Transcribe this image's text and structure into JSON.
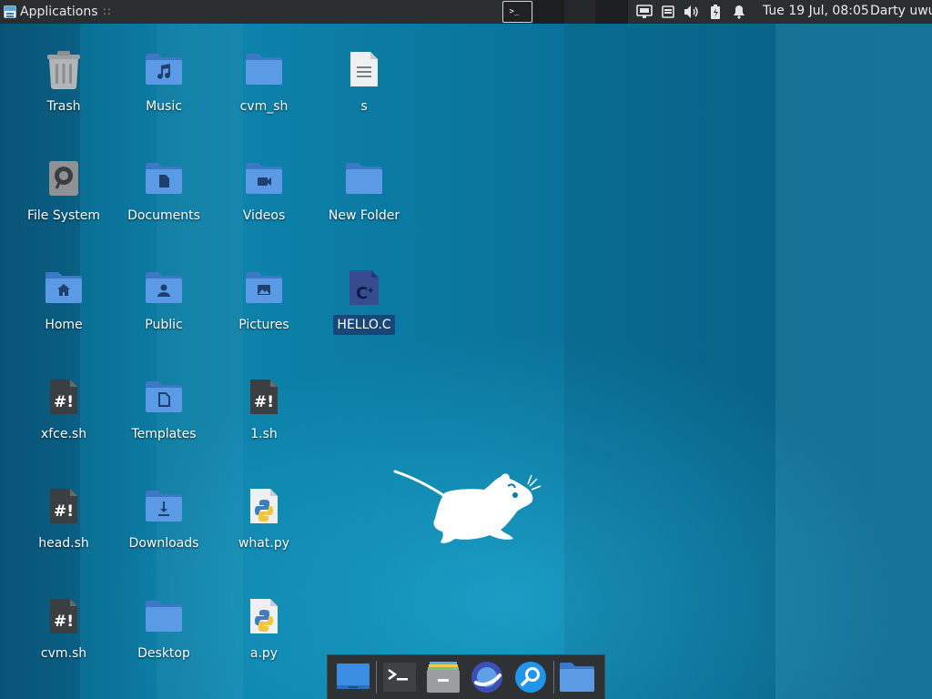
{
  "panel": {
    "applications_label": "Applications",
    "applications_sep": "∷",
    "clock": "Tue 19 Jul, 08:05",
    "user": "Darty uwu",
    "tray_icons": [
      "network-icon",
      "clipboard-icon",
      "volume-icon",
      "battery-icon",
      "notification-bell-icon"
    ],
    "active_window_icon": "terminal-icon"
  },
  "desktop": {
    "icons": [
      {
        "label": "Trash",
        "icon": "trash-icon"
      },
      {
        "label": "Music",
        "icon": "music-folder-icon"
      },
      {
        "label": "cvm_sh",
        "icon": "folder-icon"
      },
      {
        "label": "s",
        "icon": "text-file-icon"
      },
      {
        "label": "File System",
        "icon": "drive-icon"
      },
      {
        "label": "Documents",
        "icon": "documents-folder-icon"
      },
      {
        "label": "Videos",
        "icon": "videos-folder-icon"
      },
      {
        "label": "New Folder",
        "icon": "folder-icon"
      },
      {
        "label": "Home",
        "icon": "home-folder-icon"
      },
      {
        "label": "Public",
        "icon": "public-folder-icon"
      },
      {
        "label": "Pictures",
        "icon": "pictures-folder-icon"
      },
      {
        "label": "HELLO.C",
        "icon": "c-source-file-icon",
        "selected": true
      },
      {
        "label": "xfce.sh",
        "icon": "shell-script-icon"
      },
      {
        "label": "Templates",
        "icon": "templates-folder-icon"
      },
      {
        "label": "1.sh",
        "icon": "shell-script-icon"
      },
      {
        "label": "head.sh",
        "icon": "shell-script-icon"
      },
      {
        "label": "Downloads",
        "icon": "downloads-folder-icon"
      },
      {
        "label": "what.py",
        "icon": "python-file-icon"
      },
      {
        "label": "cvm.sh",
        "icon": "shell-script-icon"
      },
      {
        "label": "Desktop",
        "icon": "folder-icon"
      },
      {
        "label": "a.py",
        "icon": "python-file-icon"
      }
    ]
  },
  "dock": {
    "items": [
      "show-desktop-icon",
      "terminal-icon",
      "file-manager-icon",
      "web-browser-icon",
      "app-finder-icon",
      "folder-icon"
    ]
  },
  "colors": {
    "panel_bg": "#2b2e31",
    "folder_blue": "#4f8ee0",
    "selection": "#1b3d70",
    "desktop_teal": "#0b7aa2"
  }
}
